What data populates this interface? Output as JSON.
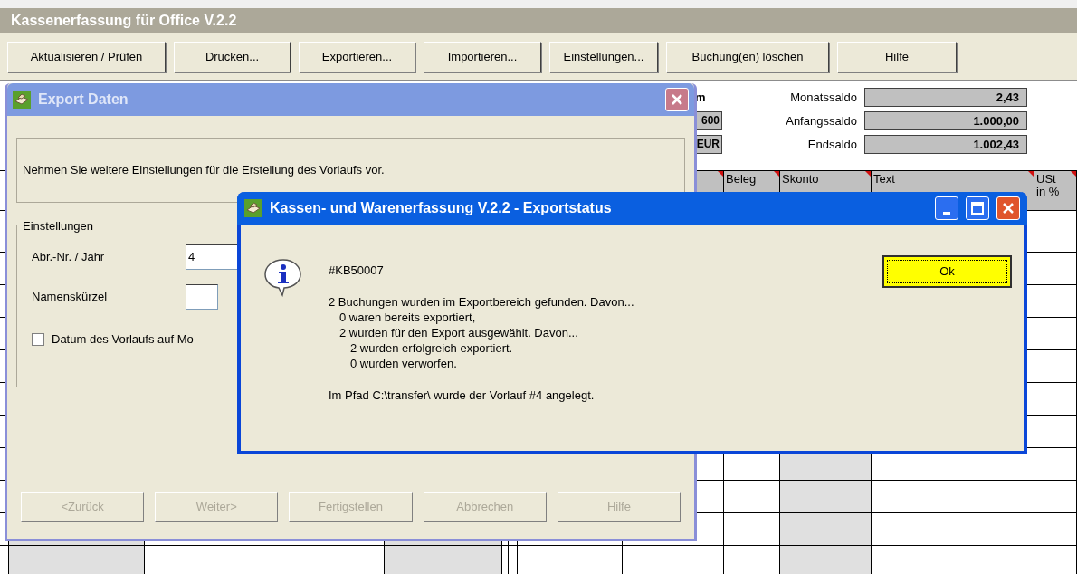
{
  "app": {
    "title": "Kassenerfassung für Office V.2.2",
    "toolbar": [
      {
        "label": "Aktualisieren / Prüfen"
      },
      {
        "label": "Drucken..."
      },
      {
        "label": "Exportieren..."
      },
      {
        "label": "Importieren..."
      },
      {
        "label": "Einstellungen..."
      },
      {
        "label": "Buchung(en) löschen"
      },
      {
        "label": "Hilfe"
      }
    ]
  },
  "summary": {
    "heading": "m",
    "fields": [
      "600",
      "EUR"
    ],
    "balances": [
      {
        "label": "Monatssaldo",
        "value": "2,43"
      },
      {
        "label": "Anfangssaldo",
        "value": "1.000,00"
      },
      {
        "label": "Endsaldo",
        "value": "1.002,43"
      }
    ]
  },
  "table": {
    "columns": [
      "Beleg",
      "Skonto",
      "Text",
      "USt\nin %"
    ]
  },
  "export_dialog": {
    "title": "Export Daten",
    "intro": "Nehmen Sie weitere Einstellungen für die Erstellung des Vorlaufs vor.",
    "group": {
      "title": "Einstellungen",
      "fields": [
        {
          "label": "Abr.-Nr. / Jahr",
          "value": "4"
        },
        {
          "label": "Namenskürzel"
        }
      ],
      "checkbox": {
        "label": "Datum des Vorlaufs auf Mo",
        "checked": false
      }
    },
    "buttons": [
      {
        "label": "<Zurück",
        "disabled": true
      },
      {
        "label": "Weiter>",
        "disabled": true
      },
      {
        "label": "Fertigstellen",
        "disabled": true
      },
      {
        "label": "Abbrechen",
        "disabled": true
      },
      {
        "label": "Hilfe",
        "disabled": true
      }
    ]
  },
  "status_dialog": {
    "title": "Kassen- und Warenerfassung V.2.2 - Exportstatus",
    "code": "#KB50007",
    "lines": [
      {
        "text": "2 Buchungen wurden im Exportbereich gefunden. Davon...",
        "children": [
          {
            "text": "0 waren bereits exportiert,"
          },
          {
            "text": "2 wurden für den Export ausgewählt. Davon...",
            "children": [
              {
                "text": "2 wurden erfolgreich exportiert."
              },
              {
                "text": "0 wurden verworfen."
              }
            ]
          }
        ]
      }
    ],
    "footer": "Im Pfad C:\\transfer\\ wurde der Vorlauf #4 angelegt.",
    "button": {
      "label": "Ok"
    }
  }
}
